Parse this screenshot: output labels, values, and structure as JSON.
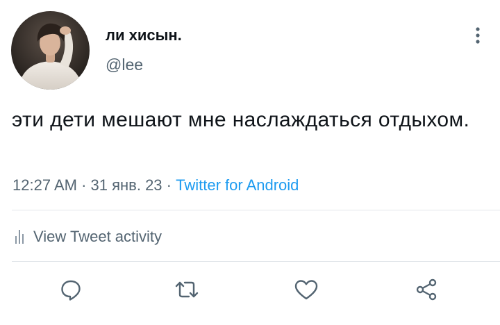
{
  "tweet": {
    "display_name": "ли хисын.",
    "handle": "@lee",
    "text": "эти дети мешают мне наслаждаться отдыхом.",
    "time": "12:27 AM",
    "separator": " · ",
    "date": "31 янв. 23",
    "source": "Twitter for Android"
  },
  "activity": {
    "label": "View Tweet activity",
    "icon": "bar-chart-icon"
  },
  "actions": [
    {
      "name": "reply",
      "icon": "reply-icon"
    },
    {
      "name": "retweet",
      "icon": "retweet-icon"
    },
    {
      "name": "like",
      "icon": "heart-icon"
    },
    {
      "name": "share",
      "icon": "share-icon"
    }
  ],
  "colors": {
    "text": "#0f1419",
    "secondary": "#536471",
    "link": "#1d9bf0",
    "divider": "#e1e6ea"
  }
}
